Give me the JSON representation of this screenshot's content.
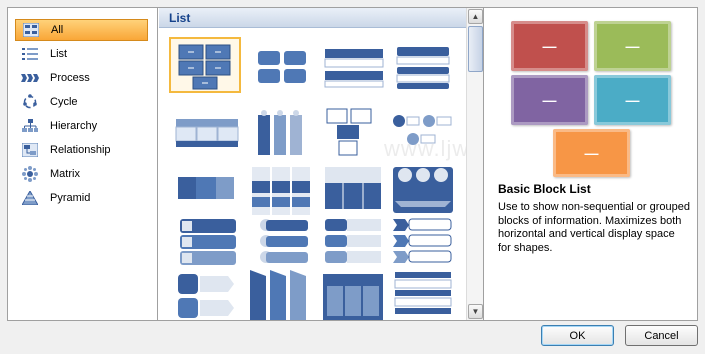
{
  "categories": [
    {
      "label": "All",
      "icon": "all-icon",
      "selected": true
    },
    {
      "label": "List",
      "icon": "list-icon"
    },
    {
      "label": "Process",
      "icon": "process-icon"
    },
    {
      "label": "Cycle",
      "icon": "cycle-icon"
    },
    {
      "label": "Hierarchy",
      "icon": "hierarchy-icon"
    },
    {
      "label": "Relationship",
      "icon": "relationship-icon"
    },
    {
      "label": "Matrix",
      "icon": "matrix-icon"
    },
    {
      "label": "Pyramid",
      "icon": "pyramid-icon"
    }
  ],
  "gallery": {
    "header": "List",
    "selected_index": 0
  },
  "preview": {
    "title": "Basic Block List",
    "description": "Use to show non-sequential or grouped blocks of information. Maximizes both horizontal and vertical display space for shapes.",
    "block_glyph": "—",
    "block_colors": [
      "#c0504d",
      "#9bbb59",
      "#8064a2",
      "#4bacc6",
      "#f79646"
    ]
  },
  "buttons": {
    "ok": "OK",
    "cancel": "Cancel"
  },
  "watermark": "www.ljwi.cn.com",
  "colors": {
    "accent_dark": "#3a5f9d",
    "accent_light": "#7e9cc8",
    "selection": "#f9a637"
  }
}
